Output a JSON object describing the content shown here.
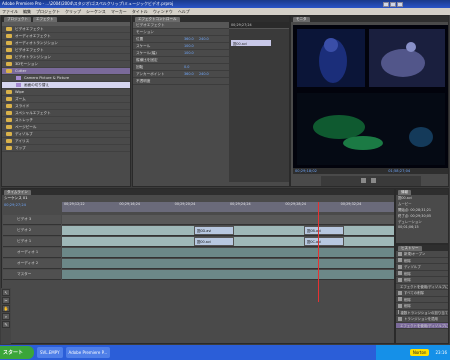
{
  "window": {
    "title": "Adobe Premiere Pro - ...\\2004\\2004\\スタジオ\\ゴスペルクリップ\\ミュージックビデオ.prproj",
    "menu": [
      "ファイル",
      "編集",
      "プロジェクト",
      "クリップ",
      "シーケンス",
      "マーカー",
      "タイトル",
      "ウィンドウ",
      "ヘルプ"
    ]
  },
  "project": {
    "tabs": [
      "プロジェクト",
      "エフェクト"
    ],
    "items": [
      {
        "label": "ビデオエフェクト",
        "type": "folder"
      },
      {
        "label": "オーディオエフェクト",
        "type": "folder"
      },
      {
        "label": "オーディオトランジション",
        "type": "folder"
      },
      {
        "label": "ビデオエフェクト",
        "type": "folder"
      },
      {
        "label": "ビデオトランジション",
        "type": "folder"
      },
      {
        "label": "3Dモーション",
        "type": "folder"
      },
      {
        "label": "Cutter",
        "type": "folder",
        "selected": true
      },
      {
        "label": "Camera Picture & Picture",
        "type": "clip",
        "child": true
      },
      {
        "label": "画面の切り替え",
        "type": "clip",
        "child": true,
        "selected2": true
      },
      {
        "label": "Wipe",
        "type": "folder"
      },
      {
        "label": "ズーム",
        "type": "folder"
      },
      {
        "label": "スライド",
        "type": "folder"
      },
      {
        "label": "スペシャルエフェクト",
        "type": "folder"
      },
      {
        "label": "ストレッチ",
        "type": "folder"
      },
      {
        "label": "ページピール",
        "type": "folder"
      },
      {
        "label": "ディゾルブ",
        "type": "folder"
      },
      {
        "label": "アイリス",
        "type": "folder"
      },
      {
        "label": "マップ",
        "type": "folder"
      }
    ]
  },
  "effects": {
    "tabs": [
      "エフェクトコントロール"
    ],
    "timecode": "00;29;27;24",
    "clip_label": "図00.avi",
    "rows": [
      {
        "label": "ビデオエフェクト",
        "val": "",
        "section": true
      },
      {
        "label": "モーション",
        "val": "",
        "section": false
      },
      {
        "label": "位置",
        "val": "360.0",
        "val2": "240.0"
      },
      {
        "label": "スケール",
        "val": "100.0",
        "val2": ""
      },
      {
        "label": "スケール(幅)",
        "val": "100.0",
        "val2": ""
      },
      {
        "label": "縦横比を固定",
        "val": "",
        "val2": ""
      },
      {
        "label": "回転",
        "val": "0.0",
        "val2": ""
      },
      {
        "label": "アンカーポイント",
        "val": "360.0",
        "val2": "240.0"
      },
      {
        "label": "不透明度",
        "val": "",
        "val2": ""
      }
    ]
  },
  "monitor": {
    "tabs": [
      "モニタ"
    ],
    "timecode_left": "00;29;18;02",
    "timecode_right": "01;58;27;04"
  },
  "timeline": {
    "tabs": [
      "タイムライン"
    ],
    "sequence": "シーケンス 01",
    "timecode": "00;29;27;24",
    "ticks": [
      "00;29;12;22",
      "00;29;16;24",
      "00;29;20;24",
      "00;29;24;24",
      "00;29;28;24",
      "00;29;32;24"
    ],
    "tracks": [
      {
        "label": "ビデオ 3",
        "kind": "video",
        "clips": []
      },
      {
        "label": "ビデオ 2",
        "kind": "video",
        "clips": [
          {
            "name": "図0D.avi"
          },
          {
            "name": "図0B.avi"
          }
        ]
      },
      {
        "label": "ビデオ 1",
        "kind": "video",
        "clips": [
          {
            "name": "図00.avi"
          },
          {
            "name": "図0C.avi"
          }
        ]
      },
      {
        "label": "オーディオ 1",
        "kind": "audio",
        "clips": []
      },
      {
        "label": "オーディオ 2",
        "kind": "audio",
        "clips": []
      },
      {
        "label": "マスター",
        "kind": "audio",
        "clips": []
      }
    ]
  },
  "info": {
    "tabs": [
      "情報"
    ],
    "lines": [
      "図00.avi",
      "ムービー",
      "開始点: 00;28;31;21",
      "終了点: 00;29;30;05",
      "デュレーション",
      "00;01;06;15"
    ]
  },
  "history": {
    "tabs": [
      "ヒストリー"
    ],
    "items": [
      {
        "label": "新規/オープン"
      },
      {
        "label": "削除"
      },
      {
        "label": "ディゾルブ"
      },
      {
        "label": "削除"
      },
      {
        "label": "削除"
      },
      {
        "label": "エフェクトを使用/ディゾルブに設定"
      },
      {
        "label": "すべての削除"
      },
      {
        "label": "削除"
      },
      {
        "label": "削除"
      },
      {
        "label": "複数トランジションの割り当て"
      },
      {
        "label": "トランジションを適用"
      },
      {
        "label": "エフェクトを使用/ディゾルブに設定",
        "selected": true
      }
    ]
  },
  "taskbar": {
    "start": "スタート",
    "lang": "SVL.EMPY",
    "app": "Adobe Premiere P...",
    "norton": "Norton",
    "clock": "23:16"
  },
  "colors": {
    "accent": "#2a55c8",
    "timeline_video": "#9fb8b8",
    "cti": "#e63232"
  }
}
